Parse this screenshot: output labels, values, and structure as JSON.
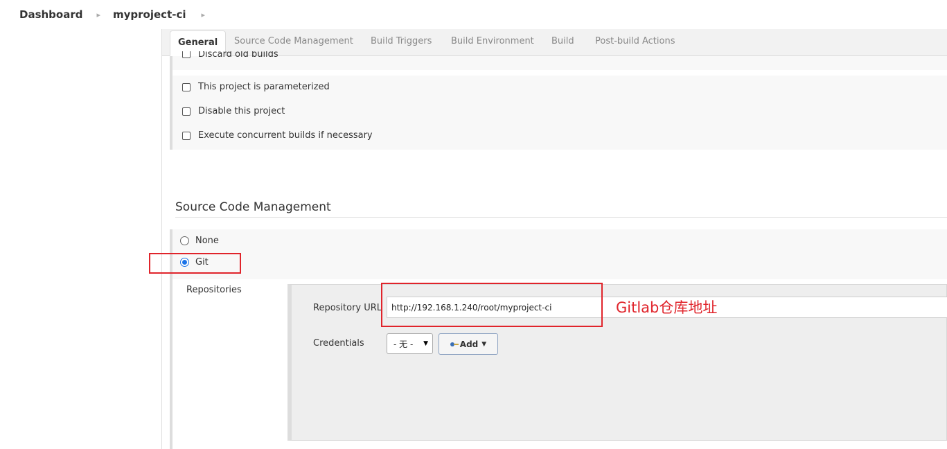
{
  "breadcrumb": {
    "items": [
      "Dashboard",
      "myproject-ci"
    ]
  },
  "tabs": [
    "General",
    "Source Code Management",
    "Build Triggers",
    "Build Environment",
    "Build",
    "Post-build Actions"
  ],
  "general": {
    "partial_option": "Discard old builds",
    "options": [
      "This project is parameterized",
      "Disable this project",
      "Execute concurrent builds if necessary"
    ]
  },
  "scm": {
    "title": "Source Code Management",
    "radio_none": "None",
    "radio_git": "Git",
    "selected": "Git",
    "repositories_label": "Repositories",
    "repo_url_label": "Repository URL",
    "repo_url_value": "http://192.168.1.240/root/myproject-ci",
    "credentials_label": "Credentials",
    "credentials_selected": "- 无 -",
    "add_label": "Add"
  },
  "annotation": {
    "text": "Gitlab仓库地址",
    "color": "#e0242b"
  },
  "icons": [
    "chevron-right-icon",
    "key-icon",
    "caret-down-icon"
  ]
}
